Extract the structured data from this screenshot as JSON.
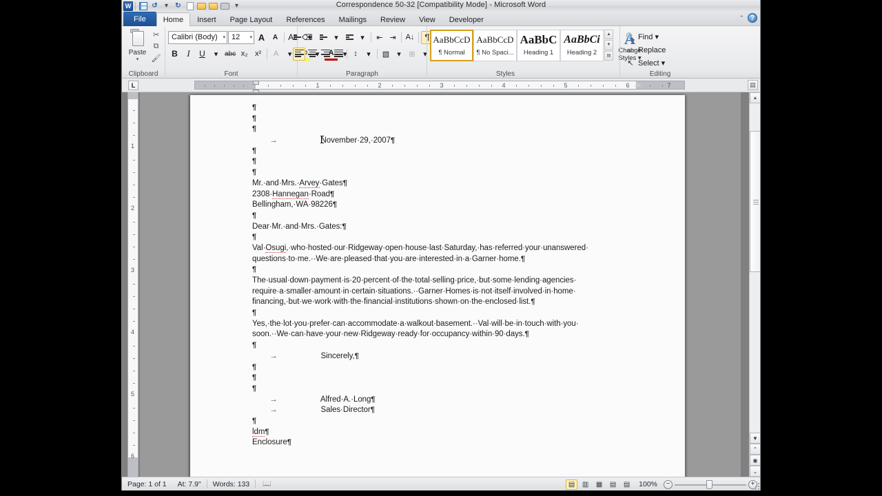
{
  "window": {
    "title": "Correspondence 50-32 [Compatibility Mode]  -  Microsoft Word",
    "app_logo": "word-logo"
  },
  "quick_access": [
    {
      "name": "save-icon",
      "label": "Save"
    },
    {
      "name": "undo-icon",
      "label": "Undo"
    },
    {
      "name": "undo-dropdown-icon",
      "label": "▾"
    },
    {
      "name": "redo-icon",
      "label": "Redo"
    },
    {
      "name": "new-document-icon",
      "label": "New"
    },
    {
      "name": "open-icon",
      "label": "Open"
    },
    {
      "name": "open-recent-icon",
      "label": "Open Recent"
    },
    {
      "name": "print-icon",
      "label": "Quick Print"
    },
    {
      "name": "customize-qat-icon",
      "label": "▾"
    }
  ],
  "tabs": [
    {
      "label": "File",
      "active": false,
      "special": true
    },
    {
      "label": "Home",
      "active": true
    },
    {
      "label": "Insert",
      "active": false
    },
    {
      "label": "Page Layout",
      "active": false
    },
    {
      "label": "References",
      "active": false
    },
    {
      "label": "Mailings",
      "active": false
    },
    {
      "label": "Review",
      "active": false
    },
    {
      "label": "View",
      "active": false
    },
    {
      "label": "Developer",
      "active": false
    }
  ],
  "tab_right": {
    "minimize_ribbon": "⌃",
    "help": "?"
  },
  "ribbon": {
    "clipboard": {
      "label": "Clipboard",
      "paste_label": "Paste",
      "paste_caret": "▾",
      "cut_icon": "✂",
      "copy_icon": "⧉",
      "format_painter_icon": "🖌",
      "dialog_launcher": "◪"
    },
    "font": {
      "label": "Font",
      "font_name": "Calibri (Body)",
      "font_size": "12",
      "grow_font": "A",
      "shrink_font": "A",
      "change_case": "Aa",
      "clear_formatting": "⌫",
      "bold": "B",
      "italic": "I",
      "underline": "U",
      "strikethrough": "abc",
      "subscript": "x₂",
      "superscript": "x²",
      "text_effects": "A",
      "highlight": "ab",
      "font_color": "A",
      "dialog_launcher": "◪"
    },
    "paragraph": {
      "label": "Paragraph",
      "bullets": "•",
      "numbering": "1.",
      "multilevel": "⊟",
      "decrease_indent": "⇤",
      "increase_indent": "⇥",
      "sort": "A↓",
      "show_marks": "¶",
      "align_left": "≡",
      "align_center": "≡",
      "align_right": "≡",
      "justify": "≡",
      "line_spacing": "↕",
      "shading": "▧",
      "borders": "⊞",
      "dialog_launcher": "◪"
    },
    "styles": {
      "label": "Styles",
      "items": [
        {
          "preview": "AaBbCcD",
          "name": "¶ Normal",
          "selected": true
        },
        {
          "preview": "AaBbCcD",
          "name": "¶ No Spaci...",
          "selected": false
        },
        {
          "preview": "AaBbC",
          "name": "Heading 1",
          "selected": false
        },
        {
          "preview": "AaBbCi",
          "name": "Heading 2",
          "selected": false
        }
      ],
      "scroll_up": "▲",
      "scroll_down": "▼",
      "more": "▤",
      "dialog_launcher": "◪",
      "change_styles_label": "Change",
      "change_styles_label2": "Styles ▾"
    },
    "editing": {
      "label": "Editing",
      "items": [
        {
          "icon": "find-icon",
          "glyph": "🔍",
          "label": "Find ▾"
        },
        {
          "icon": "replace-icon",
          "glyph": "ab",
          "label": "Replace"
        },
        {
          "icon": "select-icon",
          "glyph": "↖",
          "label": "Select ▾"
        }
      ]
    }
  },
  "ruler": {
    "tab_stop_selector": "L",
    "horizontal_numbers": [
      "1",
      "2",
      "3",
      "4",
      "5",
      "6",
      "7"
    ],
    "vertical_numbers": [
      "1",
      "2",
      "3",
      "4",
      "5",
      "6"
    ],
    "view_ruler_button": "▤"
  },
  "document": {
    "lines": [
      {
        "indent": 0,
        "segments": [
          {
            "t": "¶",
            "k": "pil"
          }
        ]
      },
      {
        "indent": 0,
        "segments": [
          {
            "t": "¶",
            "k": "pil"
          }
        ]
      },
      {
        "indent": 0,
        "segments": [
          {
            "t": "¶",
            "k": "pil"
          }
        ]
      },
      {
        "indent": 0,
        "segments": [
          {
            "t": "        ",
            "k": "p"
          },
          {
            "t": "→",
            "k": "tab"
          },
          {
            "t": "                    ",
            "k": "p"
          },
          {
            "t": "|",
            "k": "caret"
          },
          {
            "t": "November·29,·2007",
            "k": "p"
          },
          {
            "t": "¶",
            "k": "pil"
          }
        ]
      },
      {
        "indent": 0,
        "segments": [
          {
            "t": "¶",
            "k": "pil"
          }
        ]
      },
      {
        "indent": 0,
        "segments": [
          {
            "t": "¶",
            "k": "pil"
          }
        ]
      },
      {
        "indent": 0,
        "segments": [
          {
            "t": "¶",
            "k": "pil"
          }
        ]
      },
      {
        "indent": 0,
        "segments": [
          {
            "t": "Mr.·and·Mrs.·",
            "k": "p"
          },
          {
            "t": "Arvey",
            "k": "sp"
          },
          {
            "t": "·Gates",
            "k": "p"
          },
          {
            "t": "¶",
            "k": "pil"
          }
        ]
      },
      {
        "indent": 0,
        "segments": [
          {
            "t": "2308·",
            "k": "p"
          },
          {
            "t": "Hannegan",
            "k": "sp"
          },
          {
            "t": "·Road",
            "k": "p"
          },
          {
            "t": "¶",
            "k": "pil"
          }
        ]
      },
      {
        "indent": 0,
        "segments": [
          {
            "t": "Bellingham,·WA·98226",
            "k": "p"
          },
          {
            "t": "¶",
            "k": "pil"
          }
        ]
      },
      {
        "indent": 0,
        "segments": [
          {
            "t": "¶",
            "k": "pil"
          }
        ]
      },
      {
        "indent": 0,
        "segments": [
          {
            "t": "Dear·Mr.·and·Mrs.·Gates:",
            "k": "p"
          },
          {
            "t": "¶",
            "k": "pil"
          }
        ]
      },
      {
        "indent": 0,
        "segments": [
          {
            "t": "¶",
            "k": "pil"
          }
        ]
      },
      {
        "indent": 0,
        "segments": [
          {
            "t": "Val·",
            "k": "p"
          },
          {
            "t": "Osugi",
            "k": "sp"
          },
          {
            "t": ",·who·hosted·our·Ridgeway·open·house·last·Saturday,·has·referred·your·unanswered·",
            "k": "p"
          }
        ]
      },
      {
        "indent": 0,
        "segments": [
          {
            "t": "questions·to·me.··We·are·pleased·that·you·are·interested·in·a·Garner·home.",
            "k": "p"
          },
          {
            "t": "¶",
            "k": "pil"
          }
        ]
      },
      {
        "indent": 0,
        "segments": [
          {
            "t": "¶",
            "k": "pil"
          }
        ]
      },
      {
        "indent": 0,
        "segments": [
          {
            "t": "The·usual·down·payment·is·20·percent·of·the·total·selling·price,·but·some·lending·agencies·",
            "k": "p"
          }
        ]
      },
      {
        "indent": 0,
        "segments": [
          {
            "t": "require·a·smaller·amount·in·certain·situations.··Garner·Homes·is·not·itself·involved·in·home·",
            "k": "p"
          }
        ]
      },
      {
        "indent": 0,
        "segments": [
          {
            "t": "financing,·but·we·work·with·the·financial·institutions·shown·on·the·enclosed·list.",
            "k": "p"
          },
          {
            "t": "¶",
            "k": "pil"
          }
        ]
      },
      {
        "indent": 0,
        "segments": [
          {
            "t": "¶",
            "k": "pil"
          }
        ]
      },
      {
        "indent": 0,
        "segments": [
          {
            "t": "Yes,·the·lot·you·prefer·can·accommodate·a·walkout·basement.··Val·will·be·in·touch·with·you·",
            "k": "p"
          }
        ]
      },
      {
        "indent": 0,
        "segments": [
          {
            "t": "soon.··We·can·have·your·new·Ridgeway·ready·for·occupancy·within·90·days.",
            "k": "p"
          },
          {
            "t": "¶",
            "k": "pil"
          }
        ]
      },
      {
        "indent": 0,
        "segments": [
          {
            "t": "¶",
            "k": "pil"
          }
        ]
      },
      {
        "indent": 0,
        "segments": [
          {
            "t": "        ",
            "k": "p"
          },
          {
            "t": "→",
            "k": "tab"
          },
          {
            "t": "                    ",
            "k": "p"
          },
          {
            "t": "Sincerely,",
            "k": "p"
          },
          {
            "t": "¶",
            "k": "pil"
          }
        ]
      },
      {
        "indent": 0,
        "segments": [
          {
            "t": "¶",
            "k": "pil"
          }
        ]
      },
      {
        "indent": 0,
        "segments": [
          {
            "t": "¶",
            "k": "pil"
          }
        ]
      },
      {
        "indent": 0,
        "segments": [
          {
            "t": "¶",
            "k": "pil"
          }
        ]
      },
      {
        "indent": 0,
        "segments": [
          {
            "t": "        ",
            "k": "p"
          },
          {
            "t": "→",
            "k": "tab"
          },
          {
            "t": "                    ",
            "k": "p"
          },
          {
            "t": "Alfred·A.·Long",
            "k": "p"
          },
          {
            "t": "¶",
            "k": "pil"
          }
        ]
      },
      {
        "indent": 0,
        "segments": [
          {
            "t": "        ",
            "k": "p"
          },
          {
            "t": "→",
            "k": "tab"
          },
          {
            "t": "                    ",
            "k": "p"
          },
          {
            "t": "Sales·Director",
            "k": "p"
          },
          {
            "t": "¶",
            "k": "pil"
          }
        ]
      },
      {
        "indent": 0,
        "segments": [
          {
            "t": "¶",
            "k": "pil"
          }
        ]
      },
      {
        "indent": 0,
        "segments": [
          {
            "t": "ldm",
            "k": "sp"
          },
          {
            "t": "¶",
            "k": "pil"
          }
        ]
      },
      {
        "indent": 0,
        "segments": [
          {
            "t": "Enclosure",
            "k": "p"
          },
          {
            "t": "¶",
            "k": "pil"
          }
        ]
      }
    ]
  },
  "scrollbar": {
    "up": "▲",
    "down": "▼",
    "previous_page": "⌃",
    "select_browse_object": "◉",
    "next_page": "⌄"
  },
  "status_bar": {
    "page": "Page: 1 of 1",
    "at": "At: 7.9\"",
    "words": "Words: 133",
    "proofing_icon": "proofing-errors-icon",
    "views": [
      {
        "name": "print-layout-view",
        "glyph": "▤",
        "active": true
      },
      {
        "name": "full-screen-reading-view",
        "glyph": "▥",
        "active": false
      },
      {
        "name": "web-layout-view",
        "glyph": "▦",
        "active": false
      },
      {
        "name": "outline-view",
        "glyph": "▤",
        "active": false
      },
      {
        "name": "draft-view",
        "glyph": "▤",
        "active": false
      }
    ],
    "zoom_level": "100%",
    "zoom_out": "−",
    "zoom_in": "+"
  }
}
